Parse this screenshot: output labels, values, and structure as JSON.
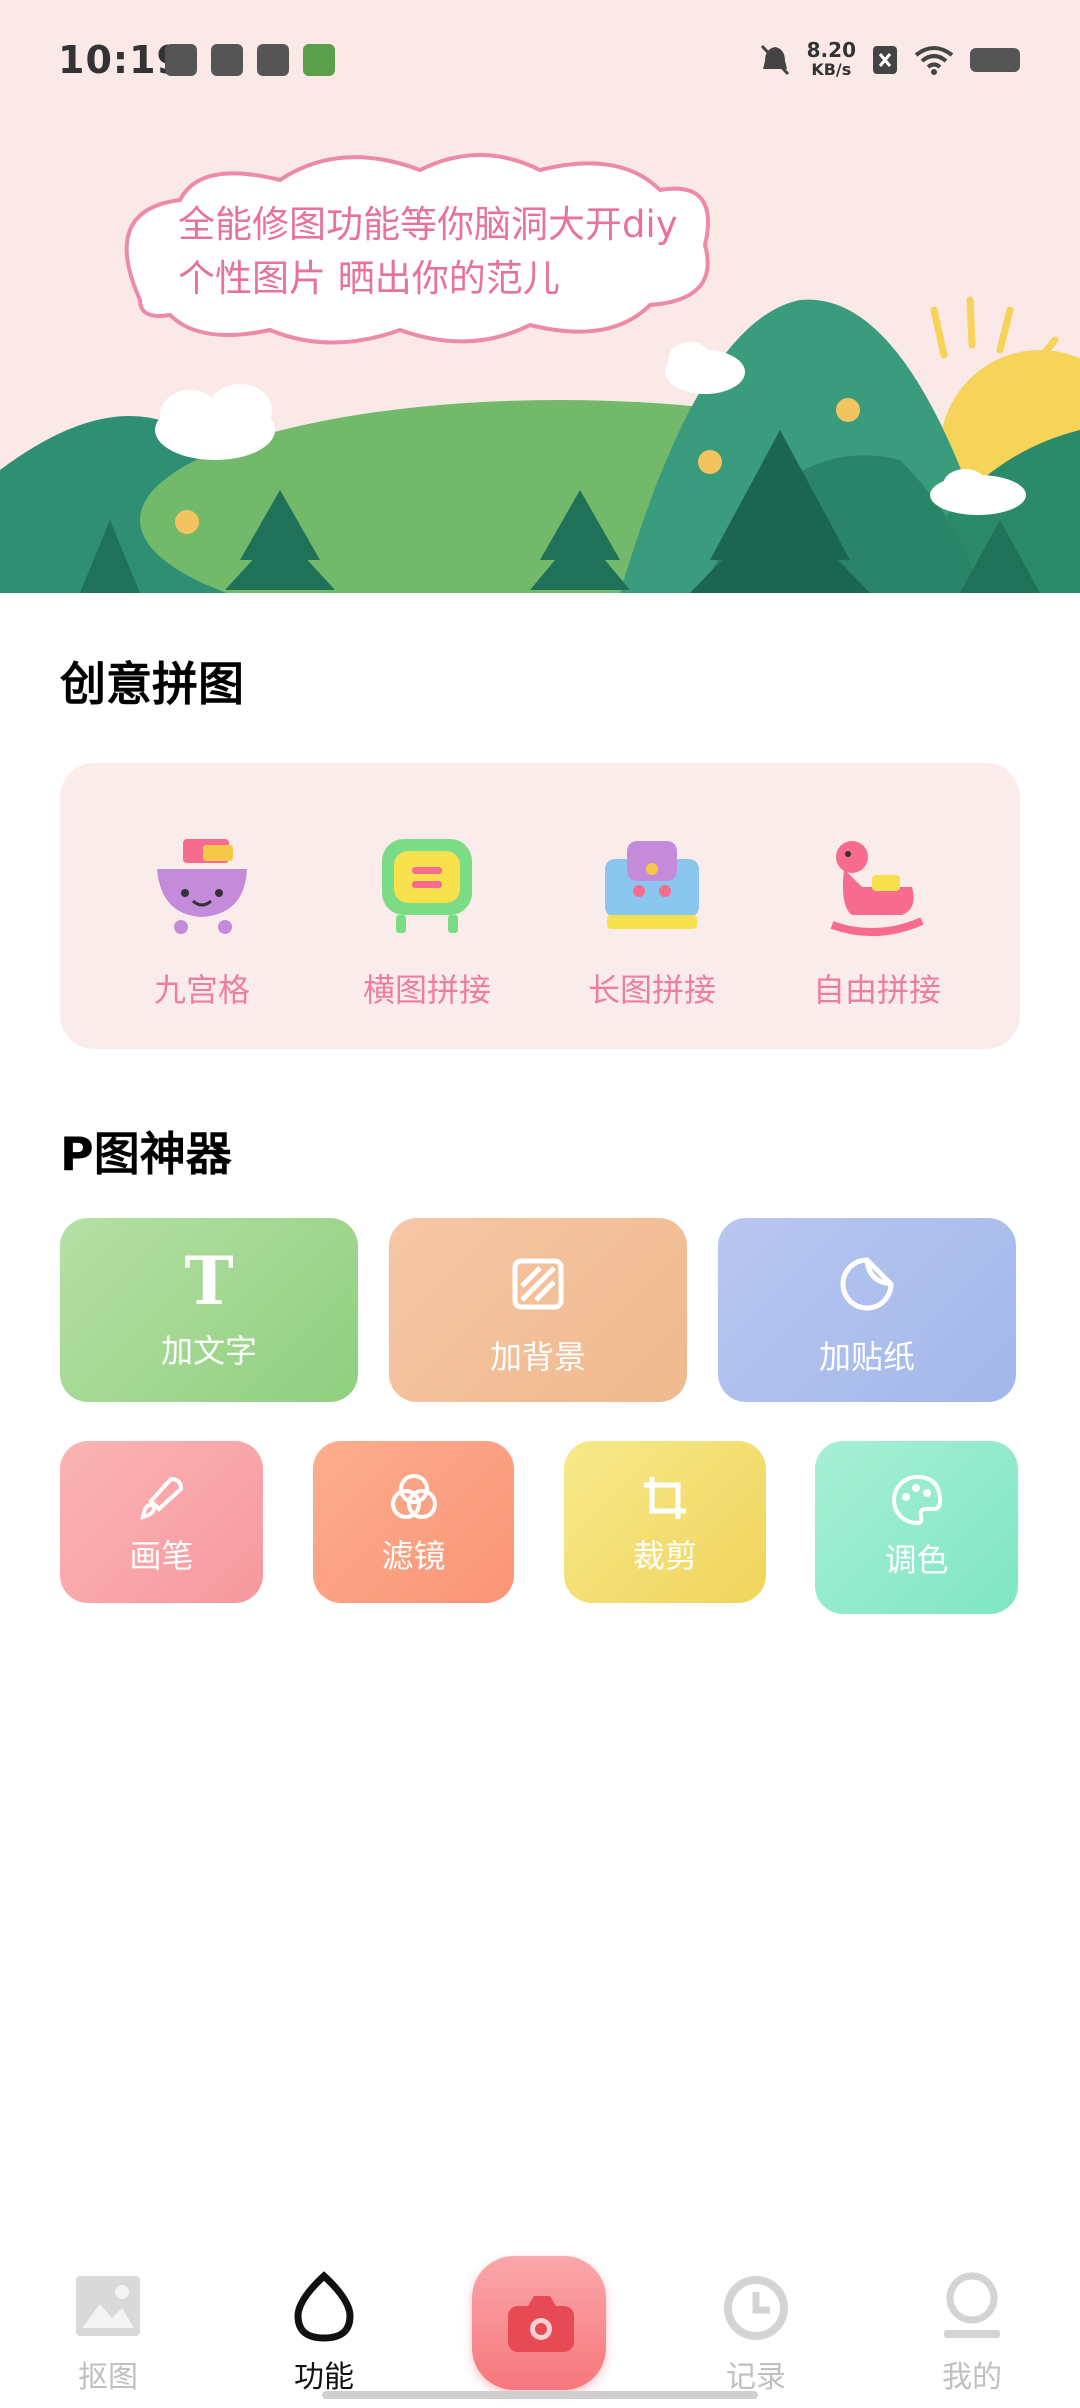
{
  "status_bar": {
    "time": "10:19",
    "net_speed_value": "8.20",
    "net_speed_unit": "KB/s"
  },
  "banner": {
    "line1": "全能修图功能等你脑洞大开diy",
    "line2": "个性图片 晒出你的范儿"
  },
  "collage": {
    "title": "创意拼图",
    "items": [
      {
        "label": "九宫格",
        "icon": "cart-emoji-icon"
      },
      {
        "label": "横图拼接",
        "icon": "tv-emoji-icon"
      },
      {
        "label": "长图拼接",
        "icon": "castle-icon"
      },
      {
        "label": "自由拼接",
        "icon": "rocking-horse-icon"
      }
    ]
  },
  "tools": {
    "title": "P图神器",
    "row1": [
      {
        "label": "加文字",
        "icon": "text-icon"
      },
      {
        "label": "加背景",
        "icon": "background-icon"
      },
      {
        "label": "加贴纸",
        "icon": "sticker-icon"
      }
    ],
    "row2": [
      {
        "label": "画笔",
        "icon": "brush-icon"
      },
      {
        "label": "滤镜",
        "icon": "filter-icon"
      },
      {
        "label": "裁剪",
        "icon": "crop-icon"
      },
      {
        "label": "调色",
        "icon": "palette-icon"
      }
    ]
  },
  "bottom_nav": {
    "items": [
      {
        "label": "抠图",
        "icon": "image-icon"
      },
      {
        "label": "功能",
        "icon": "egg-icon"
      },
      {
        "label": "记录",
        "icon": "clock-icon"
      },
      {
        "label": "我的",
        "icon": "person-icon"
      }
    ],
    "active": "功能"
  },
  "colors": {
    "accent_pink": "#ec7fa0",
    "card_green": "#9fd88f",
    "card_orange": "#f3bf98",
    "card_blue": "#adbcee",
    "card_pink": "#f9a9ad",
    "card_coral": "#fd9c80",
    "card_yellow": "#f4dd6a",
    "card_mint": "#8eebc9"
  }
}
